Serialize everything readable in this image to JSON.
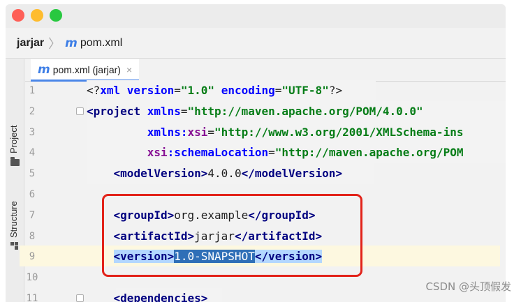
{
  "window": {
    "breadcrumb": {
      "project": "jarjar",
      "file": "pom.xml"
    }
  },
  "sidebar": {
    "project_label": "Project",
    "structure_label": "Structure"
  },
  "tabs": [
    {
      "label": "pom.xml (jarjar)",
      "icon": "maven-m-icon",
      "close": "×"
    }
  ],
  "editor": {
    "line_numbers": [
      "1",
      "2",
      "3",
      "4",
      "5",
      "6",
      "7",
      "8",
      "9",
      "10",
      "11"
    ],
    "lines": [
      [
        {
          "t": "<?",
          "c": "c-txt"
        },
        {
          "t": "xml version",
          "c": "c-attr"
        },
        {
          "t": "=",
          "c": "c-txt"
        },
        {
          "t": "\"1.0\"",
          "c": "c-val"
        },
        {
          "t": " ",
          "c": "c-txt"
        },
        {
          "t": "encoding",
          "c": "c-attr"
        },
        {
          "t": "=",
          "c": "c-txt"
        },
        {
          "t": "\"UTF-8\"",
          "c": "c-val"
        },
        {
          "t": "?>",
          "c": "c-txt"
        }
      ],
      [
        {
          "t": "<",
          "c": "c-tag"
        },
        {
          "t": "project ",
          "c": "c-tag"
        },
        {
          "t": "xmlns",
          "c": "c-attr"
        },
        {
          "t": "=",
          "c": "c-txt"
        },
        {
          "t": "\"http://maven.apache.org/POM/4.0.0\"",
          "c": "c-val"
        }
      ],
      [
        {
          "t": "         ",
          "c": "c-txt"
        },
        {
          "t": "xmlns:",
          "c": "c-attr"
        },
        {
          "t": "xsi",
          "c": "c-ns"
        },
        {
          "t": "=",
          "c": "c-txt"
        },
        {
          "t": "\"http://www.w3.org/2001/XMLSchema-ins",
          "c": "c-val"
        }
      ],
      [
        {
          "t": "         ",
          "c": "c-txt"
        },
        {
          "t": "xsi",
          "c": "c-ns"
        },
        {
          "t": ":schemaLocation",
          "c": "c-attr"
        },
        {
          "t": "=",
          "c": "c-txt"
        },
        {
          "t": "\"http://maven.apache.org/POM",
          "c": "c-val"
        }
      ],
      [
        {
          "t": "    ",
          "c": "c-txt"
        },
        {
          "t": "<",
          "c": "c-tag"
        },
        {
          "t": "modelVersion",
          "c": "c-tag"
        },
        {
          "t": ">",
          "c": "c-tag"
        },
        {
          "t": "4.0.0",
          "c": "c-txt"
        },
        {
          "t": "</",
          "c": "c-tag"
        },
        {
          "t": "modelVersion",
          "c": "c-tag"
        },
        {
          "t": ">",
          "c": "c-tag"
        }
      ],
      [],
      [
        {
          "t": "    ",
          "c": "c-txt"
        },
        {
          "t": "<",
          "c": "c-tag"
        },
        {
          "t": "groupId",
          "c": "c-tag"
        },
        {
          "t": ">",
          "c": "c-tag"
        },
        {
          "t": "org.example",
          "c": "c-txt"
        },
        {
          "t": "</",
          "c": "c-tag"
        },
        {
          "t": "groupId",
          "c": "c-tag"
        },
        {
          "t": ">",
          "c": "c-tag"
        }
      ],
      [
        {
          "t": "    ",
          "c": "c-txt"
        },
        {
          "t": "<",
          "c": "c-tag"
        },
        {
          "t": "artifactId",
          "c": "c-tag"
        },
        {
          "t": ">",
          "c": "c-tag"
        },
        {
          "t": "jarjar",
          "c": "c-txt"
        },
        {
          "t": "</",
          "c": "c-tag"
        },
        {
          "t": "artifactId",
          "c": "c-tag"
        },
        {
          "t": ">",
          "c": "c-tag"
        }
      ],
      [
        {
          "t": "    ",
          "c": "c-txt"
        },
        {
          "t": "<version>",
          "c": "c-tag c-bg"
        },
        {
          "t": "1.0-SNAPSHOT",
          "c": "c-sel"
        },
        {
          "t": "</version>",
          "c": "c-tag c-bg"
        }
      ],
      [],
      [
        {
          "t": "    ",
          "c": "c-txt"
        },
        {
          "t": "<",
          "c": "c-tag"
        },
        {
          "t": "dependencies",
          "c": "c-tag"
        },
        {
          "t": ">",
          "c": "c-tag"
        }
      ]
    ]
  },
  "watermark": "CSDN @头顶假发"
}
